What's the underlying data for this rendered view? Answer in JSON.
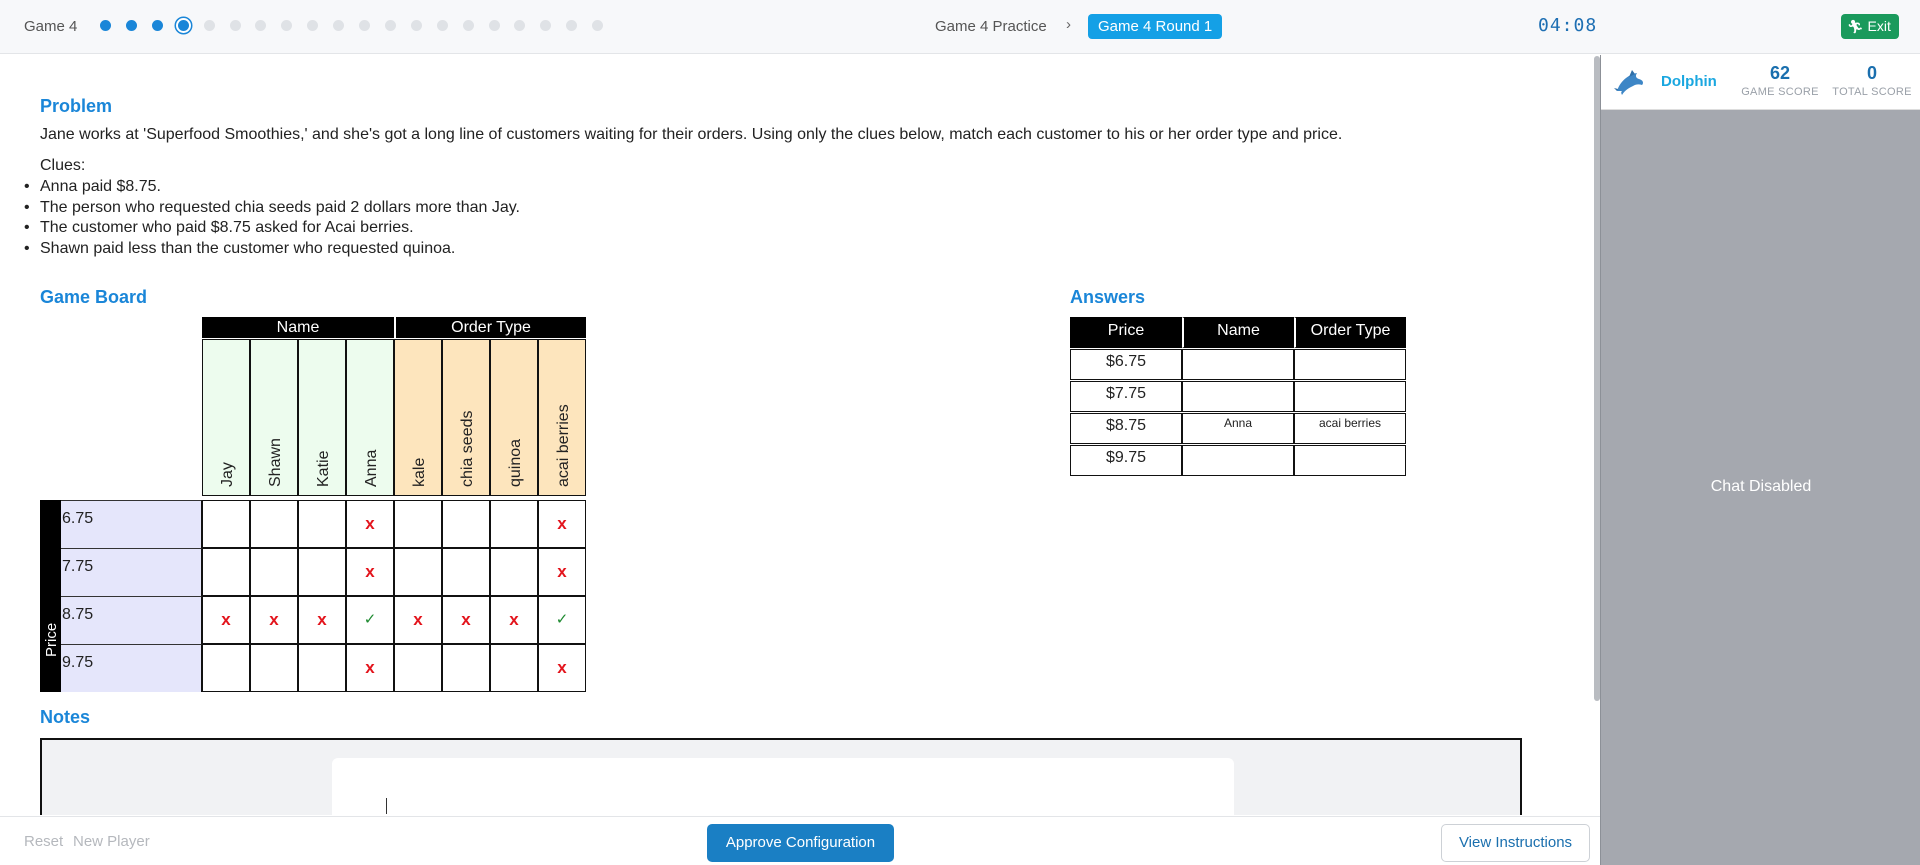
{
  "header": {
    "game_label": "Game 4",
    "progress": {
      "total": 20,
      "completed": 3,
      "current": 4
    },
    "breadcrumb_parent": "Game 4 Practice",
    "breadcrumb_current": "Game 4 Round 1",
    "timer": "04:08",
    "exit_label": "Exit"
  },
  "problem": {
    "heading": "Problem",
    "text": "Jane works at 'Superfood Smoothies,' and she's got a long line of customers waiting for their orders. Using only the clues below, match each customer to his or her order type and price.",
    "clues_title": "Clues:",
    "clues": [
      "Anna paid $8.75.",
      "The person who requested chia seeds paid 2 dollars more than Jay.",
      "The customer who paid $8.75 asked for Acai berries.",
      "Shawn paid less than the customer who requested quinoa."
    ]
  },
  "game_board": {
    "heading": "Game Board",
    "group_name": "Name",
    "group_order": "Order Type",
    "columns": [
      "Jay",
      "Shawn",
      "Katie",
      "Anna",
      "kale",
      "chia seeds",
      "quinoa",
      "acai berries"
    ],
    "row_group": "Price",
    "rows": [
      "6.75",
      "7.75",
      "8.75",
      "9.75"
    ],
    "marks": [
      [
        "",
        "",
        "",
        "x",
        "",
        "",
        "",
        "x"
      ],
      [
        "",
        "",
        "",
        "x",
        "",
        "",
        "",
        "x"
      ],
      [
        "x",
        "x",
        "x",
        "ok",
        "x",
        "x",
        "x",
        "ok"
      ],
      [
        "",
        "",
        "",
        "x",
        "",
        "",
        "",
        "x"
      ]
    ]
  },
  "answers": {
    "heading": "Answers",
    "headers": [
      "Price",
      "Name",
      "Order Type"
    ],
    "rows": [
      [
        "$6.75",
        "",
        ""
      ],
      [
        "$7.75",
        "",
        ""
      ],
      [
        "$8.75",
        "Anna",
        "acai berries"
      ],
      [
        "$9.75",
        "",
        ""
      ]
    ]
  },
  "notes": {
    "heading": "Notes"
  },
  "footer": {
    "reset_label": "Reset",
    "new_player_label": "New Player",
    "approve_label": "Approve Configuration",
    "instructions_label": "View Instructions"
  },
  "side_panel": {
    "player_icon": "dolphin-icon",
    "player_name": "Dolphin",
    "game_score_value": "62",
    "game_score_label": "GAME SCORE",
    "total_score_value": "0",
    "total_score_label": "TOTAL SCORE",
    "chat_status": "Chat Disabled"
  },
  "colors": {
    "accent": "#1a86d8",
    "name_column_bg": "#edfcee",
    "order_column_bg": "#fde5bd",
    "price_row_bg": "#e5e6fb",
    "mark_x": "#e3141c",
    "mark_ok": "#1e8a30",
    "exit_green": "#1a9a5c"
  }
}
